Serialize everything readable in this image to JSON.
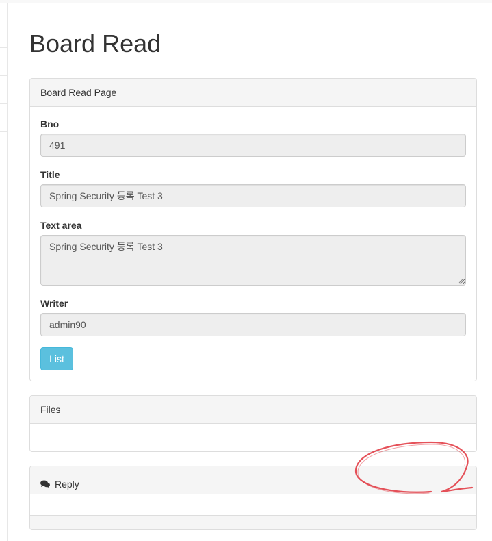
{
  "page": {
    "title": "Board Read"
  },
  "read_panel": {
    "heading": "Board Read Page",
    "fields": {
      "bno": {
        "label": "Bno",
        "value": "491"
      },
      "title": {
        "label": "Title",
        "value": "Spring Security 등록 Test 3"
      },
      "content": {
        "label": "Text area",
        "value": "Spring Security 등록 Test 3"
      },
      "writer": {
        "label": "Writer",
        "value": "admin90"
      }
    },
    "list_button": "List"
  },
  "files_panel": {
    "heading": "Files"
  },
  "reply_panel": {
    "heading": "Reply",
    "icon": "comments-icon"
  },
  "colors": {
    "button_info": "#5bc0de",
    "panel_heading_bg": "#f5f5f5",
    "readonly_field_bg": "#eeeeee",
    "annotation": "#e0323c"
  }
}
